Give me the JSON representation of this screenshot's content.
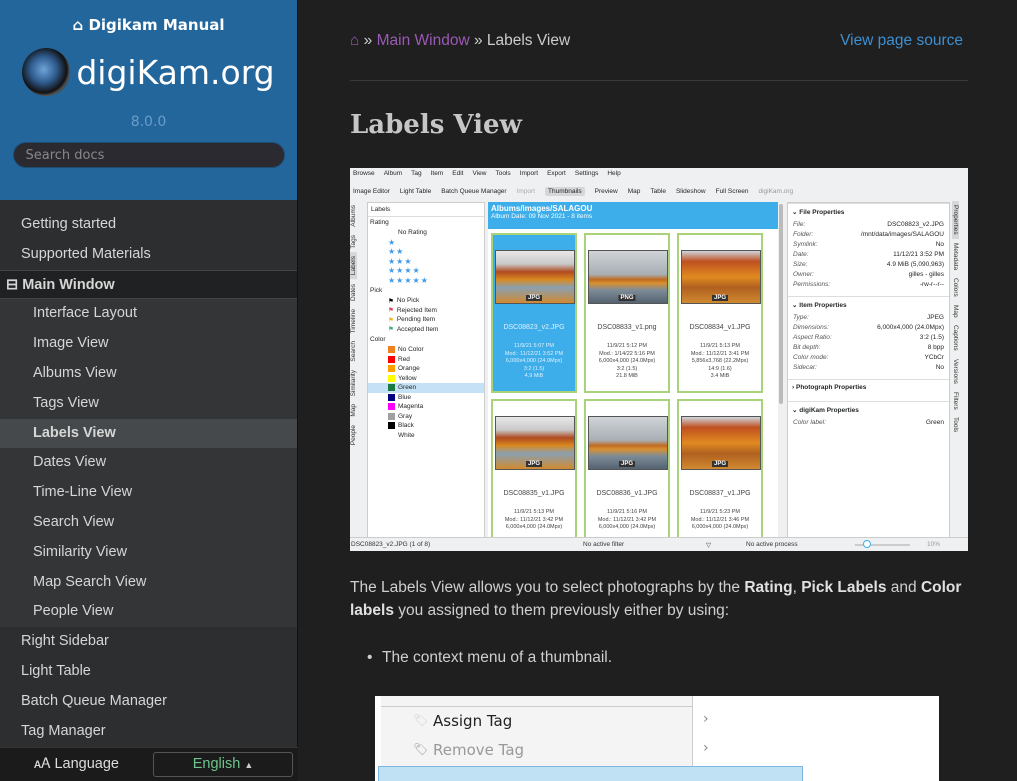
{
  "sidebar": {
    "home": "Digikam Manual",
    "site": "digiKam.org",
    "version": "8.0.0",
    "search_placeholder": "Search docs",
    "items": [
      {
        "label": "Getting started"
      },
      {
        "label": "Supported Materials"
      },
      {
        "label": "Main Window"
      },
      {
        "label": "Interface Layout"
      },
      {
        "label": "Image View"
      },
      {
        "label": "Albums View"
      },
      {
        "label": "Tags View"
      },
      {
        "label": "Labels View"
      },
      {
        "label": "Dates View"
      },
      {
        "label": "Time-Line View"
      },
      {
        "label": "Search View"
      },
      {
        "label": "Similarity View"
      },
      {
        "label": "Map Search View"
      },
      {
        "label": "People View"
      },
      {
        "label": "Right Sidebar"
      },
      {
        "label": "Light Table"
      },
      {
        "label": "Batch Queue Manager"
      },
      {
        "label": "Tag Manager"
      }
    ],
    "language_label": "Language",
    "language_value": "English"
  },
  "breadcrumb": {
    "parent": "Main Window",
    "current": "Labels View",
    "source": "View page source"
  },
  "title": "Labels View",
  "screenshot": {
    "menu": [
      "Browse",
      "Album",
      "Tag",
      "Item",
      "Edit",
      "View",
      "Tools",
      "Import",
      "Export",
      "Settings",
      "Help"
    ],
    "toolbar": [
      "Image Editor",
      "Light Table",
      "Batch Queue Manager",
      "Import",
      "Thumbnails",
      "Preview",
      "Map",
      "Table",
      "Slideshow",
      "Full Screen",
      "digiKam.org"
    ],
    "left_tabs": [
      "Albums",
      "Tags",
      "Labels",
      "Dates",
      "Timeline",
      "Search",
      "Similarity",
      "Map",
      "People"
    ],
    "right_tabs": [
      "Properties",
      "Metadata",
      "Colors",
      "Map",
      "Captions",
      "Versions",
      "Filters",
      "Tools"
    ],
    "labels": {
      "title": "Labels",
      "rating_title": "Rating",
      "no_rating": "No Rating",
      "pick_title": "Pick",
      "picks": [
        {
          "label": "No Pick",
          "color": "#000000"
        },
        {
          "label": "Rejected Item",
          "color": "#d9425a"
        },
        {
          "label": "Pending Item",
          "color": "#f0b520"
        },
        {
          "label": "Accepted Item",
          "color": "#3aa97a"
        }
      ],
      "color_title": "Color",
      "colors": [
        {
          "label": "No Color",
          "color": "#f08020"
        },
        {
          "label": "Red",
          "color": "#ff0000"
        },
        {
          "label": "Orange",
          "color": "#ff9f00"
        },
        {
          "label": "Yellow",
          "color": "#ffff00"
        },
        {
          "label": "Green",
          "color": "#1d7a45"
        },
        {
          "label": "Blue",
          "color": "#00007f"
        },
        {
          "label": "Magenta",
          "color": "#ff00ff"
        },
        {
          "label": "Gray",
          "color": "#a0a0a0"
        },
        {
          "label": "Black",
          "color": "#000000"
        },
        {
          "label": "White",
          "color": "#ffffff"
        }
      ]
    },
    "album": {
      "path": "Albums/images/SALAGOU",
      "date": "Album Date: 09 Nov 2021 - 8 items"
    },
    "thumbs": [
      {
        "fmt": "JPG",
        "name": "DSC08823_v2.JPG",
        "meta": [
          "11/9/21 5:07 PM",
          "Mod.: 11/12/21 3:52 PM",
          "6,000x4,000 (24.0Mpx)",
          "3:2 (1.5)",
          "4.9 MiB"
        ]
      },
      {
        "fmt": "PNG",
        "name": "DSC08833_v1.png",
        "meta": [
          "11/9/21 5:12 PM",
          "Mod.: 1/14/22 5:16 PM",
          "6,000x4,000 (24.0Mpx)",
          "3:2 (1.5)",
          "21.8 MiB"
        ]
      },
      {
        "fmt": "JPG",
        "name": "DSC08834_v1.JPG",
        "meta": [
          "11/9/21 5:13 PM",
          "Mod.: 11/12/21 3:41 PM",
          "5,856x3,768 (22.2Mpx)",
          "14:9 (1.6)",
          "3.4 MiB"
        ]
      },
      {
        "fmt": "JPG",
        "name": "DSC08835_v1.JPG",
        "meta": [
          "11/9/21 5:13 PM",
          "Mod.: 11/12/21 3:42 PM",
          "6,000x4,000 (24.0Mpx)"
        ]
      },
      {
        "fmt": "JPG",
        "name": "DSC08836_v1.JPG",
        "meta": [
          "11/9/21 5:16 PM",
          "Mod.: 11/12/21 3:42 PM",
          "6,000x4,000 (24.0Mpx)"
        ]
      },
      {
        "fmt": "JPG",
        "name": "DSC08837_v1.JPG",
        "meta": [
          "11/9/21 5:23 PM",
          "Mod.: 11/12/21 3:46 PM",
          "6,000x4,000 (24.0Mpx)"
        ]
      }
    ],
    "file_props": {
      "title": "File Properties",
      "rows": [
        [
          "File:",
          "DSC08823_v2.JPG"
        ],
        [
          "Folder:",
          "/mnt/data/images/SALAGOU"
        ],
        [
          "Symlink:",
          "No"
        ],
        [
          "Date:",
          "11/12/21 3:52 PM"
        ],
        [
          "Size:",
          "4.9 MiB (5,090,963)"
        ],
        [
          "Owner:",
          "gilles - gilles"
        ],
        [
          "Permissions:",
          "-rw-r--r--"
        ]
      ]
    },
    "item_props": {
      "title": "Item Properties",
      "rows": [
        [
          "Type:",
          "JPEG"
        ],
        [
          "Dimensions:",
          "6,000x4,000 (24.0Mpx)"
        ],
        [
          "Aspect Ratio:",
          "3:2 (1.5)"
        ],
        [
          "Bit depth:",
          "8 bpp"
        ],
        [
          "Color mode:",
          "YCbCr"
        ],
        [
          "Sidecar:",
          "No"
        ]
      ]
    },
    "photo_props": {
      "title": "Photograph Properties"
    },
    "dk_props": {
      "title": "digiKam Properties",
      "rows": [
        [
          "Color label:",
          "Green"
        ]
      ]
    },
    "status": {
      "file": "DSC08823_v2.JPG (1 of 8)",
      "filter": "No active filter",
      "process": "No active process",
      "zoom": "10%",
      "zoom_level": 0.1
    }
  },
  "paragraph": {
    "p1": "The Labels View allows you to select photographs by the ",
    "rating": "Rating",
    "sep1": ", ",
    "pick": "Pick Labels",
    "and": " and ",
    "color": "Color labels",
    "p2": " you assigned to them previously either by using:"
  },
  "bullet": "The context menu of a thumbnail.",
  "screenshot2": {
    "items": [
      "Assign Tag",
      "Remove Tag"
    ]
  }
}
